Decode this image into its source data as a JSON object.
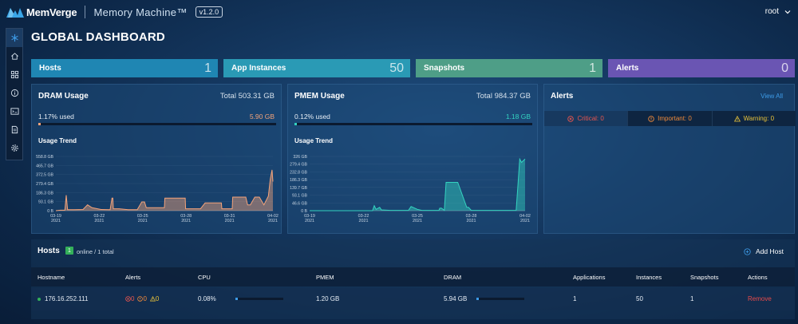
{
  "brand": {
    "name": "MemVerge",
    "product": "Memory Machine™",
    "version": "v1.2.0"
  },
  "user": {
    "name": "root"
  },
  "page_title": "GLOBAL DASHBOARD",
  "sidebar": {
    "items": [
      {
        "icon": "snowflake-icon",
        "active": true
      },
      {
        "icon": "home-icon"
      },
      {
        "icon": "grid-icon"
      },
      {
        "icon": "info-icon"
      },
      {
        "icon": "terminal-icon"
      },
      {
        "icon": "report-icon"
      },
      {
        "icon": "gear-icon"
      }
    ]
  },
  "stats": [
    {
      "label": "Hosts",
      "value": "1",
      "color": "#1f86b3"
    },
    {
      "label": "App Instances",
      "value": "50",
      "color": "#2a9ab5"
    },
    {
      "label": "Snapshots",
      "value": "1",
      "color": "#4e9e87"
    },
    {
      "label": "Alerts",
      "value": "0",
      "color": "#6a55b3"
    }
  ],
  "dram": {
    "title": "DRAM Usage",
    "total": "Total 503.31 GB",
    "used_label": "1.17% used",
    "used_value": "5.90 GB",
    "used_fraction": 0.0117,
    "color": "#f4a37a",
    "trend_label": "Usage Trend"
  },
  "pmem": {
    "title": "PMEM Usage",
    "total": "Total 984.37 GB",
    "used_label": "0.12% used",
    "used_value": "1.18 GB",
    "used_fraction": 0.0012,
    "color": "#34d3c0",
    "trend_label": "Usage Trend"
  },
  "chart_data": [
    {
      "type": "area",
      "title": "Usage Trend",
      "y_ticks": [
        "558.8 GB",
        "465.7 GB",
        "372.5 GB",
        "279.4 GB",
        "186.3 GB",
        "93.1 GB",
        "0 B"
      ],
      "y_tick_values": [
        558.8,
        465.7,
        372.5,
        279.4,
        186.3,
        93.1,
        0
      ],
      "ylim": [
        0,
        558.8
      ],
      "x_ticks": [
        [
          "03-19",
          "2021"
        ],
        [
          "03-22",
          "2021"
        ],
        [
          "03-25",
          "2021"
        ],
        [
          "03-28",
          "2021"
        ],
        [
          "03-31",
          "2021"
        ],
        [
          "04-02",
          "2021"
        ]
      ],
      "x": [
        0,
        0.5,
        1,
        1.15,
        1.3,
        2,
        3,
        3.5,
        4,
        5,
        6,
        6.2,
        6.3,
        6.35,
        6.5,
        7,
        8,
        9,
        9.5,
        9.55,
        9.8,
        10,
        11,
        12,
        12.05,
        12.2,
        12.25,
        13,
        14,
        14.3,
        14.35,
        15,
        15.5,
        16,
        16.5,
        16.55,
        17,
        17.5,
        18,
        18.3,
        18.35,
        19.5,
        19.55,
        20.5,
        21,
        21.2,
        21.3,
        21.5,
        22,
        22.5,
        23,
        23.5,
        23.7,
        23.9,
        24
      ],
      "values": [
        0,
        5,
        5,
        160,
        10,
        10,
        12,
        60,
        30,
        12,
        10,
        130,
        130,
        20,
        20,
        20,
        10,
        10,
        90,
        90,
        90,
        30,
        30,
        30,
        130,
        130,
        130,
        130,
        130,
        130,
        20,
        20,
        20,
        20,
        80,
        80,
        80,
        80,
        80,
        80,
        20,
        20,
        140,
        140,
        140,
        60,
        60,
        60,
        140,
        140,
        60,
        150,
        320,
        420,
        300
      ],
      "series": [
        {
          "name": "DRAM",
          "color": "#f4a37a"
        }
      ]
    },
    {
      "type": "area",
      "title": "Usage Trend",
      "y_ticks": [
        "326 GB",
        "279.4 GB",
        "232.8 GB",
        "186.3 GB",
        "139.7 GB",
        "93.1 GB",
        "46.6 GB",
        "0 B"
      ],
      "y_tick_values": [
        326,
        279.4,
        232.8,
        186.3,
        139.7,
        93.1,
        46.6,
        0
      ],
      "ylim": [
        0,
        326
      ],
      "x_ticks": [
        [
          "03-19",
          "2021"
        ],
        [
          "03-22",
          "2021"
        ],
        [
          "03-25",
          "2021"
        ],
        [
          "03-28",
          "2021"
        ],
        [
          "04-02",
          "2021"
        ]
      ],
      "x": [
        0,
        3,
        6,
        7,
        7.2,
        7.4,
        7.8,
        8,
        9,
        11,
        11.3,
        12,
        12.5,
        13,
        14.4,
        14.5,
        14.7,
        15,
        15.2,
        15.3,
        16.5,
        17.5,
        17.6,
        17.7,
        18,
        20,
        20.5,
        21,
        21.5,
        22,
        22.5,
        23,
        23.2,
        23.4,
        23.6,
        24
      ],
      "values": [
        0,
        0,
        0,
        0,
        30,
        8,
        20,
        5,
        2,
        2,
        25,
        8,
        2,
        2,
        2,
        15,
        15,
        2,
        170,
        170,
        170,
        20,
        20,
        20,
        2,
        2,
        2,
        2,
        2,
        2,
        2,
        2,
        150,
        310,
        290,
        310
      ],
      "series": [
        {
          "name": "PMEM",
          "color": "#34d3c0"
        }
      ]
    }
  ],
  "alerts": {
    "title": "Alerts",
    "view_all": "View All",
    "critical": "Critical: 0",
    "important": "Important: 0",
    "warning": "Warning: 0",
    "critical_color": "#e8554e",
    "important_color": "#f08a3a",
    "warning_color": "#e8c23a"
  },
  "hosts": {
    "title": "Hosts",
    "online_count": "1",
    "online_text": "online / 1 total",
    "add_label": "Add Host",
    "columns": [
      "Hostname",
      "Alerts",
      "CPU",
      "PMEM",
      "DRAM",
      "Applications",
      "Instances",
      "Snapshots",
      "Actions"
    ],
    "rows": [
      {
        "hostname": "176.16.252.111",
        "alerts_critical": "0",
        "alerts_important": "0",
        "alerts_warning": "0",
        "cpu": "0.08%",
        "cpu_fraction": 0.0008,
        "pmem": "1.20 GB",
        "dram": "5.94 GB",
        "dram_fraction": 0.0118,
        "applications": "1",
        "instances": "50",
        "snapshots": "1",
        "action": "Remove"
      }
    ]
  }
}
